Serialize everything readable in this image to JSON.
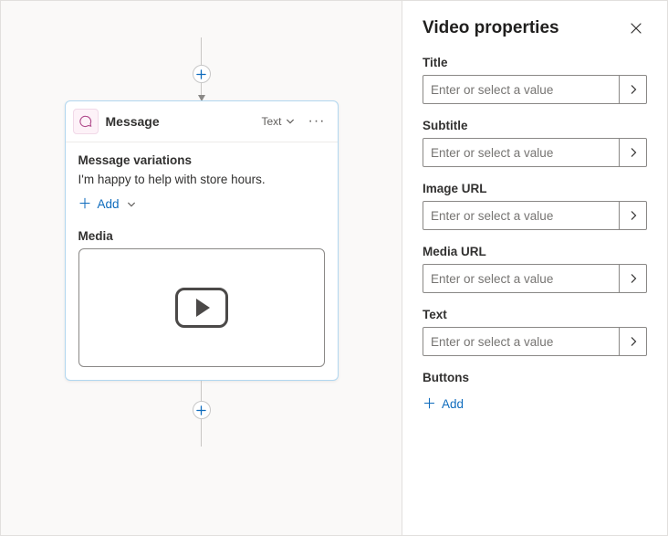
{
  "canvas": {
    "node": {
      "type_label": "Message",
      "mode_label": "Text",
      "icon": "chat-icon",
      "variations": {
        "section_label": "Message variations",
        "items": [
          "I'm happy to help with store hours."
        ],
        "add_label": "Add"
      },
      "media": {
        "section_label": "Media",
        "kind": "video-placeholder"
      }
    }
  },
  "panel": {
    "title": "Video properties",
    "fields": {
      "title": {
        "label": "Title",
        "placeholder": "Enter or select a value",
        "value": ""
      },
      "subtitle": {
        "label": "Subtitle",
        "placeholder": "Enter or select a value",
        "value": ""
      },
      "image_url": {
        "label": "Image URL",
        "placeholder": "Enter or select a value",
        "value": ""
      },
      "media_url": {
        "label": "Media URL",
        "placeholder": "Enter or select a value",
        "value": ""
      },
      "text": {
        "label": "Text",
        "placeholder": "Enter or select a value",
        "value": ""
      }
    },
    "buttons": {
      "section_label": "Buttons",
      "add_label": "Add"
    }
  },
  "colors": {
    "accent": "#0f6cbd",
    "node_border": "#b2d7f0"
  }
}
